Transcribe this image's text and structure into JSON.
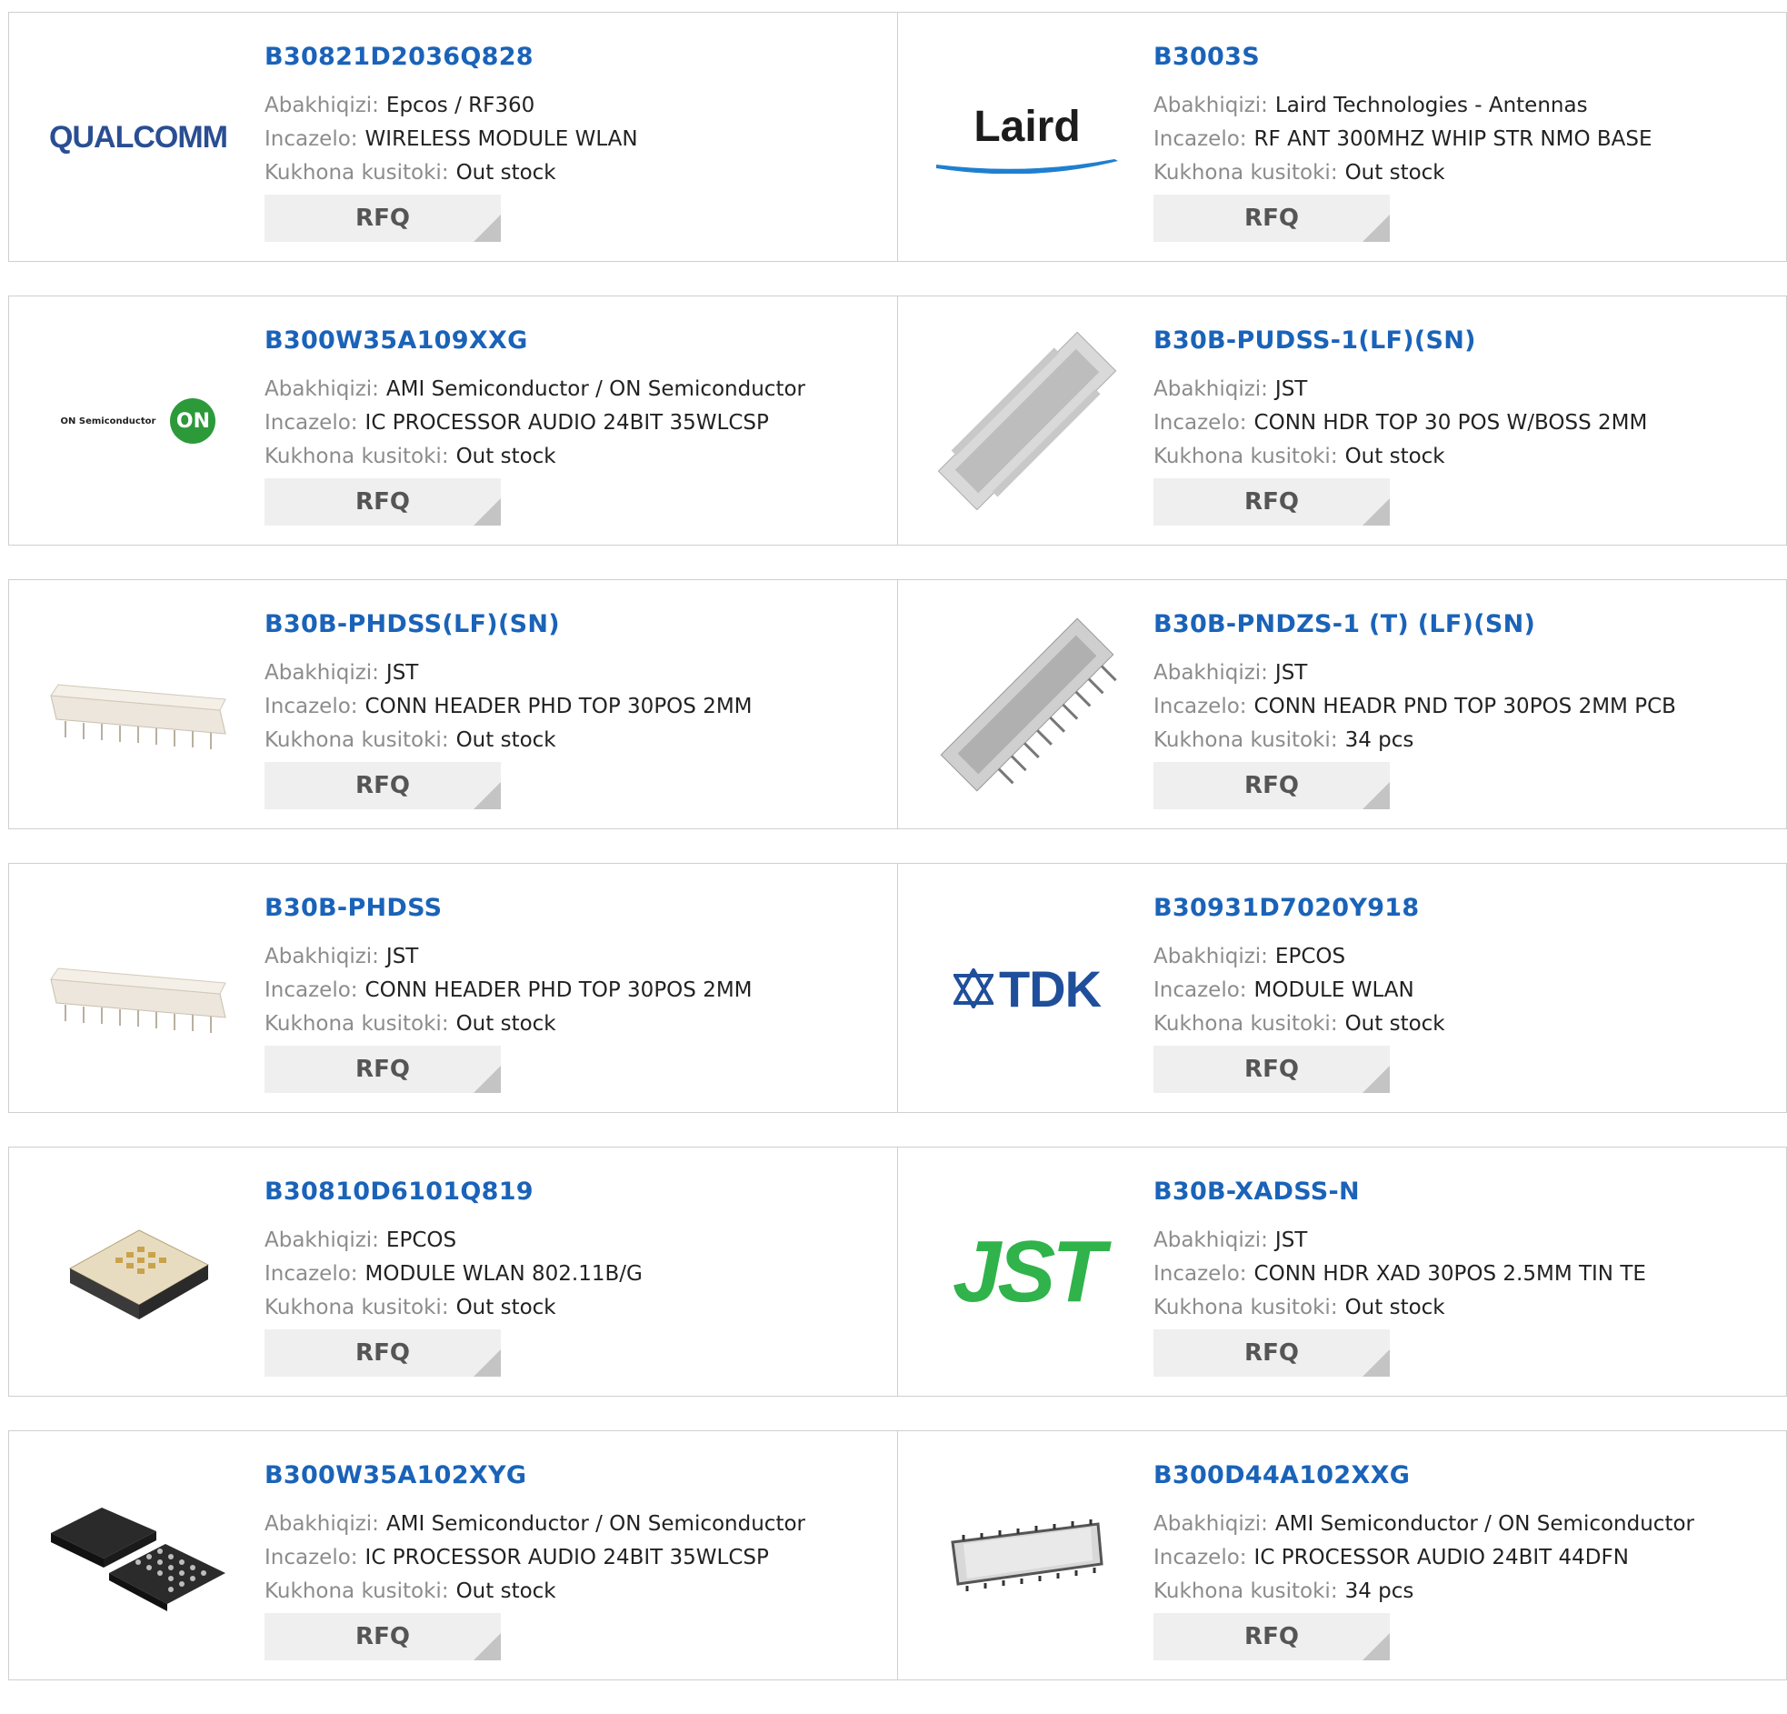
{
  "labels": {
    "manufacturer": "Abakhiqizi:",
    "description": "Incazelo:",
    "stock": "Kukhona kusitoki:",
    "rfq": "RFQ"
  },
  "products": [
    {
      "part": "B30821D2036Q828",
      "manufacturer": "Epcos / RF360",
      "description": "WIRELESS MODULE WLAN",
      "stock": "Out stock",
      "image": "qualcomm-logo",
      "logo_text": "QUALCOMM"
    },
    {
      "part": "B3003S",
      "manufacturer": "Laird Technologies - Antennas",
      "description": "RF ANT 300MHZ WHIP STR NMO BASE",
      "stock": "Out stock",
      "image": "laird-logo",
      "logo_text": "Laird"
    },
    {
      "part": "B300W35A109XXG",
      "manufacturer": "AMI Semiconductor / ON Semiconductor",
      "description": "IC PROCESSOR AUDIO 24BIT 35WLCSP",
      "stock": "Out stock",
      "image": "on-semiconductor-logo",
      "logo_text": "ON Semiconductor",
      "logo_badge": "ON"
    },
    {
      "part": "B30B-PUDSS-1(LF)(SN)",
      "manufacturer": "JST",
      "description": "CONN HDR TOP 30 POS W/BOSS 2MM",
      "stock": "Out stock",
      "image": "connector-header-photo"
    },
    {
      "part": "B30B-PHDSS(LF)(SN)",
      "manufacturer": "JST",
      "description": "CONN HEADER PHD TOP 30POS 2MM",
      "stock": "Out stock",
      "image": "connector-strip-photo"
    },
    {
      "part": "B30B-PNDZS-1 (T) (LF)(SN)",
      "manufacturer": "JST",
      "description": "CONN HEADR PND TOP 30POS 2MM PCB",
      "stock": "34 pcs",
      "image": "connector-pins-photo"
    },
    {
      "part": "B30B-PHDSS",
      "manufacturer": "JST",
      "description": "CONN HEADER PHD TOP 30POS 2MM",
      "stock": "Out stock",
      "image": "connector-strip-photo"
    },
    {
      "part": "B30931D7020Y918",
      "manufacturer": "EPCOS",
      "description": "MODULE WLAN",
      "stock": "Out stock",
      "image": "tdk-logo",
      "logo_text": "TDK"
    },
    {
      "part": "B30810D6101Q819",
      "manufacturer": "EPCOS",
      "description": "MODULE WLAN 802.11B/G",
      "stock": "Out stock",
      "image": "module-chip-photo"
    },
    {
      "part": "B30B-XADSS-N",
      "manufacturer": "JST",
      "description": "CONN HDR XAD 30POS 2.5MM TIN TE",
      "stock": "Out stock",
      "image": "jst-logo",
      "logo_text": "JST"
    },
    {
      "part": "B300W35A102XYG",
      "manufacturer": "AMI Semiconductor / ON Semiconductor",
      "description": "IC PROCESSOR AUDIO 24BIT 35WLCSP",
      "stock": "Out stock",
      "image": "bga-chip-photo"
    },
    {
      "part": "B300D44A102XXG",
      "manufacturer": "AMI Semiconductor / ON Semiconductor",
      "description": "IC PROCESSOR AUDIO 24BIT 44DFN",
      "stock": "34 pcs",
      "image": "dfn-chip-photo"
    }
  ]
}
